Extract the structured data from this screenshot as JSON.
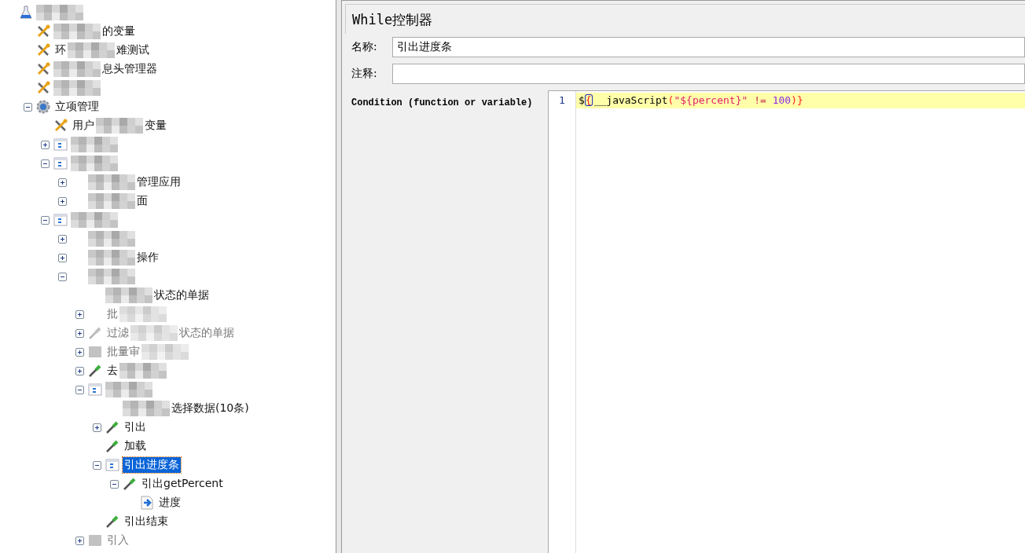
{
  "tree": {
    "nodes": [
      {
        "kind": "flask",
        "redacted": true,
        "selected": false,
        "disabled": false,
        "children": [
          {
            "kind": "tools",
            "redacted": true,
            "label": "的变量",
            "selected": false,
            "disabled": false
          },
          {
            "kind": "tools",
            "prefix": "环",
            "redacted": true,
            "label": "难测试",
            "selected": false,
            "disabled": false
          },
          {
            "kind": "tools",
            "redacted": true,
            "label": "息头管理器",
            "selected": false,
            "disabled": false
          },
          {
            "kind": "tools",
            "redacted": true,
            "selected": false,
            "disabled": false
          },
          {
            "kind": "gear",
            "label": "立项管理",
            "expanded": true,
            "selected": false,
            "disabled": false,
            "children": [
              {
                "kind": "tools",
                "prefix": "用户",
                "redacted": true,
                "label": "变量",
                "selected": false,
                "disabled": false
              },
              {
                "kind": "controller",
                "redacted": true,
                "expanded": false,
                "selected": false,
                "disabled": false
              },
              {
                "kind": "controller",
                "redacted": true,
                "expanded": true,
                "selected": false,
                "disabled": false,
                "children": [
                  {
                    "redacted": true,
                    "label": "管理应用",
                    "expanded": false,
                    "selected": false,
                    "disabled": false
                  },
                  {
                    "redacted": true,
                    "label": "面",
                    "expanded": false,
                    "selected": false,
                    "disabled": false
                  }
                ]
              },
              {
                "kind": "controller",
                "redacted": true,
                "expanded": true,
                "selected": false,
                "disabled": false,
                "children": [
                  {
                    "redacted": true,
                    "expanded": false,
                    "selected": false,
                    "disabled": false
                  },
                  {
                    "redacted": true,
                    "label": "操作",
                    "expanded": false,
                    "selected": false,
                    "disabled": false
                  },
                  {
                    "redacted": true,
                    "expanded": true,
                    "selected": false,
                    "disabled": false,
                    "children": [
                      {
                        "redacted": true,
                        "label": "状态的单据",
                        "selected": false,
                        "disabled": false
                      },
                      {
                        "prefix": "批",
                        "redacted": true,
                        "expanded": false,
                        "selected": false,
                        "disabled": true
                      },
                      {
                        "kind": "sampler",
                        "prefix": "过滤",
                        "redacted": true,
                        "label": "状态的单据",
                        "expanded": false,
                        "selected": false,
                        "disabled": true
                      },
                      {
                        "kind": "disabled-controller",
                        "prefix": "批量审",
                        "redacted": true,
                        "expanded": false,
                        "selected": false,
                        "disabled": true
                      },
                      {
                        "kind": "sampler",
                        "prefix": "去",
                        "redacted": true,
                        "expanded": false,
                        "selected": false,
                        "disabled": false
                      },
                      {
                        "kind": "controller",
                        "redacted": true,
                        "expanded": true,
                        "selected": false,
                        "disabled": false,
                        "children": [
                          {
                            "redacted": true,
                            "label": "选择数据(10条)",
                            "selected": false,
                            "disabled": false
                          },
                          {
                            "kind": "sampler",
                            "label": "引出",
                            "expanded": false,
                            "selected": false,
                            "disabled": false
                          },
                          {
                            "kind": "sampler",
                            "label": "加载",
                            "selected": false,
                            "disabled": false
                          },
                          {
                            "kind": "controller",
                            "label": "引出进度条",
                            "expanded": true,
                            "selected": true,
                            "disabled": false,
                            "children": [
                              {
                                "kind": "sampler",
                                "label": "引出getPercent",
                                "expanded": true,
                                "selected": false,
                                "disabled": false,
                                "children": [
                                  {
                                    "kind": "action",
                                    "label": "进度",
                                    "selected": false,
                                    "disabled": false
                                  }
                                ]
                              }
                            ]
                          },
                          {
                            "kind": "sampler",
                            "label": "引出结束",
                            "selected": false,
                            "disabled": false
                          }
                        ]
                      },
                      {
                        "kind": "disabled-controller",
                        "label": "引入",
                        "expanded": false,
                        "selected": false,
                        "disabled": true
                      }
                    ]
                  }
                ]
              }
            ]
          }
        ]
      }
    ]
  },
  "editor": {
    "title": "While控制器",
    "fields": [
      {
        "label": "名称:",
        "value": "引出进度条"
      },
      {
        "label": "注释:"
      }
    ],
    "condition_label": "Condition (function or variable)",
    "lines": [
      {
        "number": "1",
        "highlighted": true,
        "tokens": [
          {
            "text": "$",
            "kind": "plain",
            "caret": false
          },
          {
            "text": "{",
            "kind": "bracket",
            "caret": true
          },
          {
            "text": "__javaScript",
            "kind": "plain",
            "caret": false
          },
          {
            "text": "(",
            "kind": "bracket",
            "caret": false
          },
          {
            "text": "\"${percent}\"",
            "kind": "string",
            "caret": false
          },
          {
            "text": " != ",
            "kind": "operator",
            "caret": false
          },
          {
            "text": "100",
            "kind": "number",
            "caret": false
          },
          {
            "text": ")}",
            "kind": "bracket",
            "caret": false
          }
        ]
      }
    ]
  }
}
